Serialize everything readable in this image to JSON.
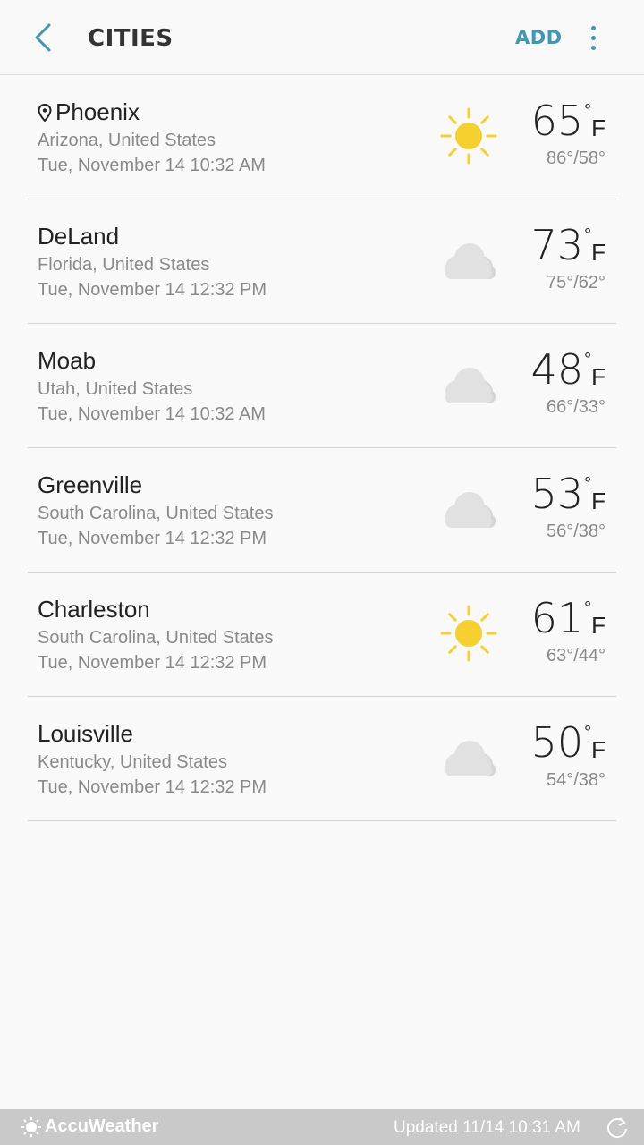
{
  "header": {
    "title": "CITIES",
    "add_label": "ADD"
  },
  "cities": [
    {
      "name": "Phoenix",
      "current_location": true,
      "region": "Arizona, United States",
      "time": "Tue, November 14 10:32 AM",
      "condition_icon": "sun-icon",
      "temp": "65",
      "unit": "F",
      "hilo": "86°/58°"
    },
    {
      "name": "DeLand",
      "current_location": false,
      "region": "Florida, United States",
      "time": "Tue, November 14 12:32 PM",
      "condition_icon": "cloud-icon",
      "temp": "73",
      "unit": "F",
      "hilo": "75°/62°"
    },
    {
      "name": "Moab",
      "current_location": false,
      "region": "Utah, United States",
      "time": "Tue, November 14 10:32 AM",
      "condition_icon": "cloud-icon",
      "temp": "48",
      "unit": "F",
      "hilo": "66°/33°"
    },
    {
      "name": "Greenville",
      "current_location": false,
      "region": "South Carolina, United States",
      "time": "Tue, November 14 12:32 PM",
      "condition_icon": "cloud-icon",
      "temp": "53",
      "unit": "F",
      "hilo": "56°/38°"
    },
    {
      "name": "Charleston",
      "current_location": false,
      "region": "South Carolina, United States",
      "time": "Tue, November 14 12:32 PM",
      "condition_icon": "sun-icon",
      "temp": "61",
      "unit": "F",
      "hilo": "63°/44°"
    },
    {
      "name": "Louisville",
      "current_location": false,
      "region": "Kentucky, United States",
      "time": "Tue, November 14 12:32 PM",
      "condition_icon": "cloud-icon",
      "temp": "50",
      "unit": "F",
      "hilo": "54°/38°"
    }
  ],
  "footer": {
    "brand": "AccuWeather",
    "updated": "Updated 11/14  10:31 AM"
  },
  "colors": {
    "accent": "#3f97b5",
    "sun": "#f6d02f",
    "cloud": "#e1e1e1",
    "footer_bg": "#c9c9c9"
  }
}
